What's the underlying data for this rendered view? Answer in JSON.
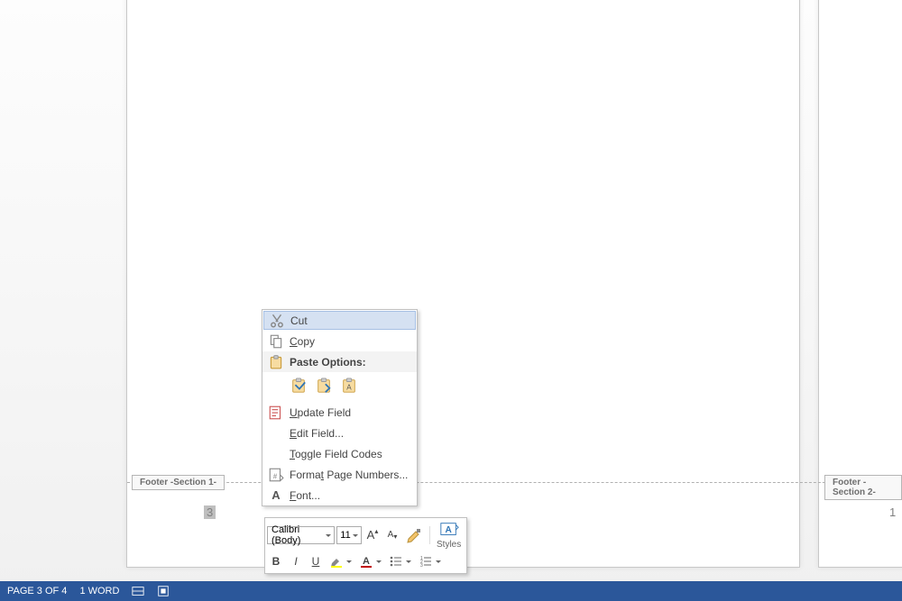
{
  "footer": {
    "tab1": "Footer -Section 1-",
    "tab2": "Footer -Section 2-",
    "page_left": "3",
    "page_right": "1"
  },
  "contextmenu": {
    "cut": "Cut",
    "copy": "Copy",
    "paste_label": "Paste Options:",
    "update_field": "Update Field",
    "edit_field": "Edit Field...",
    "toggle_codes": "Toggle Field Codes",
    "format_pn": "Format Page Numbers...",
    "font": "Font..."
  },
  "minitoolbar": {
    "font_name": "Calibri (Body)",
    "font_size": "11",
    "bold": "B",
    "italic": "I",
    "underline": "U",
    "styles": "Styles"
  },
  "statusbar": {
    "page": "PAGE 3 OF 4",
    "words": "1 WORD"
  }
}
